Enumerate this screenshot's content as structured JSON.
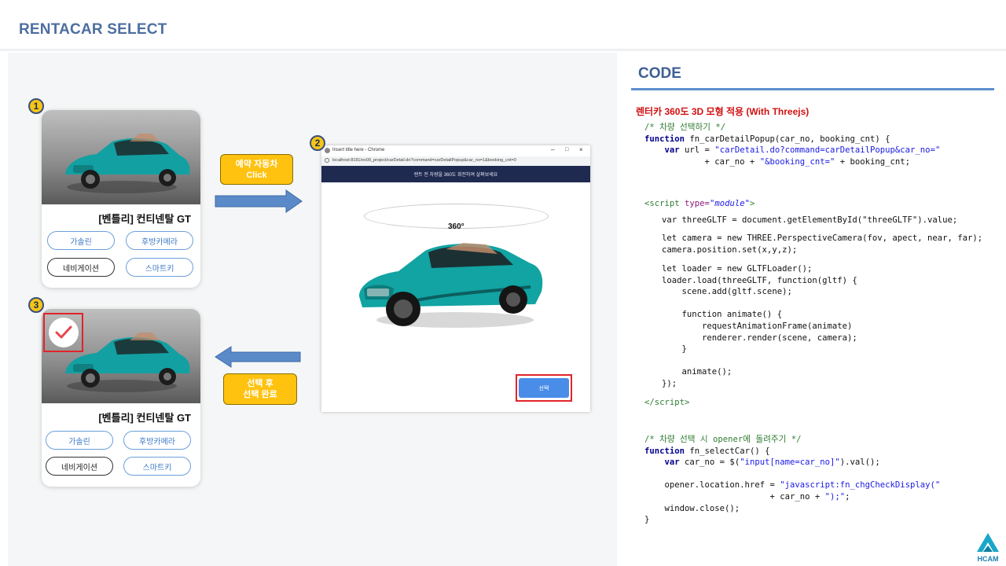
{
  "header": {
    "title": "RENTACAR SELECT"
  },
  "steps": {
    "one": "1",
    "two": "2",
    "three": "3"
  },
  "card": {
    "name": "[벤틀리] 컨티넨탈 GT",
    "options": [
      "가솔린",
      "후방카메라",
      "네비게이션",
      "스마트키"
    ]
  },
  "callouts": {
    "reserve": {
      "line1": "예약 자동차",
      "line2": "Click"
    },
    "done": {
      "line1": "선택 후",
      "line2": "선택 완료"
    }
  },
  "popup": {
    "window_title": "Insert title here - Chrome",
    "url": "localhost:8181/ex09_project/carDetail.do?command=carDetailPopup&car_no=1&booking_cnt=0",
    "banner": "렌트 전 차량을 360도 회전하여 살펴보세요",
    "degree": "360°",
    "select_label": "선택"
  },
  "code_panel": {
    "title": "CODE",
    "subtitle": "렌터카 360도 3D 모형 적용 (With Threejs)"
  },
  "logo": {
    "text": "HCAM"
  },
  "colors": {
    "accent_blue": "#4d6ea0",
    "badge_yellow": "#f5c518",
    "callout_orange": "#ffc20e",
    "highlight_red": "#e0242a",
    "car_teal": "#12a3a3"
  }
}
